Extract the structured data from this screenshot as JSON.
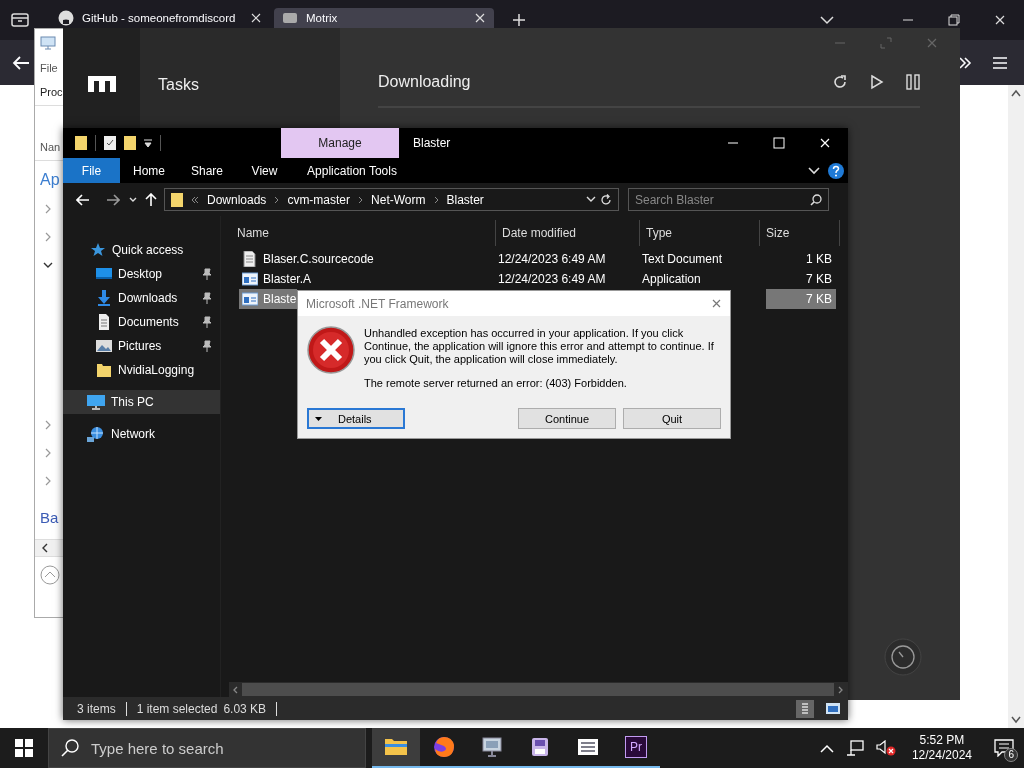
{
  "browser": {
    "tabs": [
      {
        "label": "GitHub - someonefromdiscord",
        "selected": false
      },
      {
        "label": "Motrix",
        "selected": true
      }
    ]
  },
  "back_window": {
    "menu": "File",
    "tab": "Proc",
    "column": "Nan",
    "section": "Ap",
    "link": "Ba",
    "tree_rows": [
      {
        "expanded": false
      },
      {
        "expanded": false
      },
      {
        "expanded": true
      },
      {
        "expanded": false
      },
      {
        "expanded": false
      },
      {
        "expanded": false
      }
    ]
  },
  "motrix": {
    "nav_title": "Tasks",
    "heading": "Downloading"
  },
  "explorer": {
    "title": "Blaster",
    "context_tab": "Manage",
    "ribbon_tabs": [
      {
        "label": "File",
        "selected": true
      },
      {
        "label": "Home",
        "selected": false
      },
      {
        "label": "Share",
        "selected": false
      },
      {
        "label": "View",
        "selected": false
      },
      {
        "label": "Application Tools",
        "selected": false
      }
    ],
    "breadcrumb": [
      "Downloads",
      "cvm-master",
      "Net-Worm",
      "Blaster"
    ],
    "search": {
      "placeholder": "Search Blaster"
    },
    "nav": [
      {
        "label": "Quick access",
        "kind": "star",
        "selected": false,
        "children": [
          {
            "label": "Desktop",
            "kind": "desktop",
            "pinned": true,
            "selected": false
          },
          {
            "label": "Downloads",
            "kind": "download",
            "pinned": true,
            "selected": false
          },
          {
            "label": "Documents",
            "kind": "document",
            "pinned": true,
            "selected": false
          },
          {
            "label": "Pictures",
            "kind": "pictures",
            "pinned": true,
            "selected": false
          },
          {
            "label": "NvidiaLogging",
            "kind": "folder",
            "pinned": false,
            "selected": false
          }
        ]
      },
      {
        "label": "This PC",
        "kind": "pc",
        "selected": true
      },
      {
        "label": "Network",
        "kind": "network",
        "selected": false
      }
    ],
    "columns": [
      "Name",
      "Date modified",
      "Type",
      "Size"
    ],
    "rows": [
      {
        "kind": "text",
        "name": "Blaser.C.sourcecode",
        "date": "12/24/2023 6:49 AM",
        "type": "Text Document",
        "size": "1 KB",
        "selected": false
      },
      {
        "kind": "app",
        "name": "Blaster.A",
        "date": "12/24/2023 6:49 AM",
        "type": "Application",
        "size": "7 KB",
        "selected": false
      },
      {
        "kind": "app",
        "name": "Blaste",
        "size": "7 KB",
        "selected": true
      }
    ],
    "status": {
      "count": "3 items",
      "selection": "1 item selected",
      "size": "6.03 KB"
    }
  },
  "dialog": {
    "title": "Microsoft .NET Framework",
    "message": "Unhandled exception has occurred in your application. If you click Continue, the application will ignore this error and attempt to continue. If you click Quit, the application will close immediately.",
    "detail": "The remote server returned an error: (403) Forbidden.",
    "buttons": [
      {
        "label": "Details",
        "kind": "toggle",
        "focused": true
      },
      {
        "label": "Continue",
        "kind": "push",
        "focused": false
      },
      {
        "label": "Quit",
        "kind": "push",
        "focused": false
      }
    ]
  },
  "taskbar": {
    "search": {
      "placeholder": "Type here to search"
    },
    "apps": [
      {
        "kind": "folder",
        "selected": true
      },
      {
        "kind": "firefox",
        "selected": false
      },
      {
        "kind": "monitor",
        "selected": false
      },
      {
        "kind": "disk",
        "selected": false
      },
      {
        "kind": "list",
        "selected": false
      },
      {
        "kind": "premiere",
        "label": "Pr",
        "selected": false
      }
    ],
    "time": "5:52 PM",
    "date": "12/24/2024",
    "notifications": "6"
  }
}
